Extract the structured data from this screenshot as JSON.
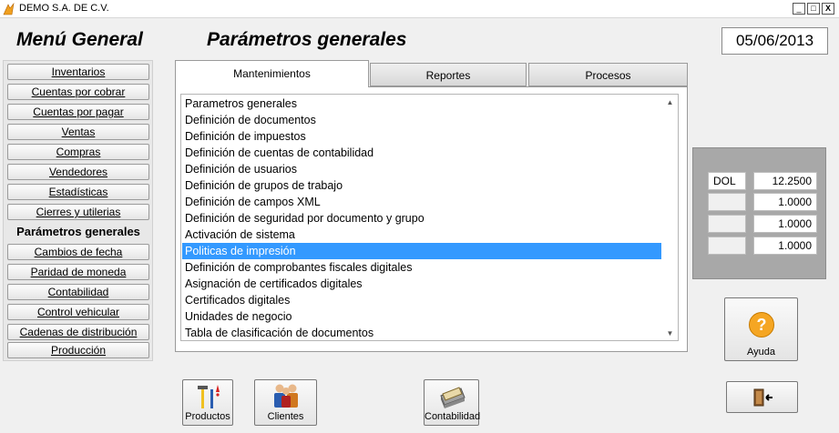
{
  "window": {
    "title": "DEMO  S.A. DE C.V.",
    "minimize": "_",
    "maximize": "□",
    "close": "X"
  },
  "header": {
    "menu_title": "Menú General",
    "section_title": "Parámetros generales",
    "date": "05/06/2013"
  },
  "menu": {
    "items": [
      {
        "label": "Inventarios",
        "active": false
      },
      {
        "label": "Cuentas por cobrar",
        "active": false
      },
      {
        "label": "Cuentas por pagar",
        "active": false
      },
      {
        "label": "Ventas",
        "active": false
      },
      {
        "label": "Compras",
        "active": false
      },
      {
        "label": "Vendedores",
        "active": false
      },
      {
        "label": "Estadísticas",
        "active": false
      },
      {
        "label": "Cierres y utilerias",
        "active": false
      },
      {
        "label": "Parámetros generales",
        "active": true
      },
      {
        "label": "Cambios de fecha",
        "active": false
      },
      {
        "label": "Paridad de moneda",
        "active": false
      },
      {
        "label": "Contabilidad",
        "active": false
      },
      {
        "label": "Control vehicular",
        "active": false
      },
      {
        "label": "Cadenas de distribución",
        "active": false
      },
      {
        "label": "Producción",
        "active": false
      }
    ]
  },
  "tabs": [
    {
      "label": "Mantenimientos",
      "active": true
    },
    {
      "label": "Reportes",
      "active": false
    },
    {
      "label": "Procesos",
      "active": false
    }
  ],
  "list": {
    "items": [
      "Parametros generales",
      "Definición de documentos",
      "Definición de impuestos",
      "Definición de cuentas de contabilidad",
      "Definición de usuarios",
      "Definición de grupos de trabajo",
      "Definición de campos XML",
      "Definición de seguridad por documento y grupo",
      "Activación  de sistema",
      "Politicas de  impresión",
      "Definición de comprobantes fiscales digitales",
      "Asignación de certificados digitales",
      "Certificados digitales",
      "Unidades de negocio",
      "Tabla de clasificación de documentos"
    ],
    "selected_index": 9,
    "scroll_up": "▲",
    "scroll_down": "▼"
  },
  "currency": {
    "rows": [
      {
        "code": "DOL",
        "rate": "12.2500"
      },
      {
        "code": "",
        "rate": "1.0000"
      },
      {
        "code": "",
        "rate": "1.0000"
      },
      {
        "code": "",
        "rate": "1.0000"
      }
    ]
  },
  "buttons": {
    "help": "Ayuda",
    "products": "Productos",
    "clients": "Clientes",
    "accounting": "Contabilidad"
  },
  "colors": {
    "selection": "#3399ff",
    "help_icon": "#f5a623"
  }
}
